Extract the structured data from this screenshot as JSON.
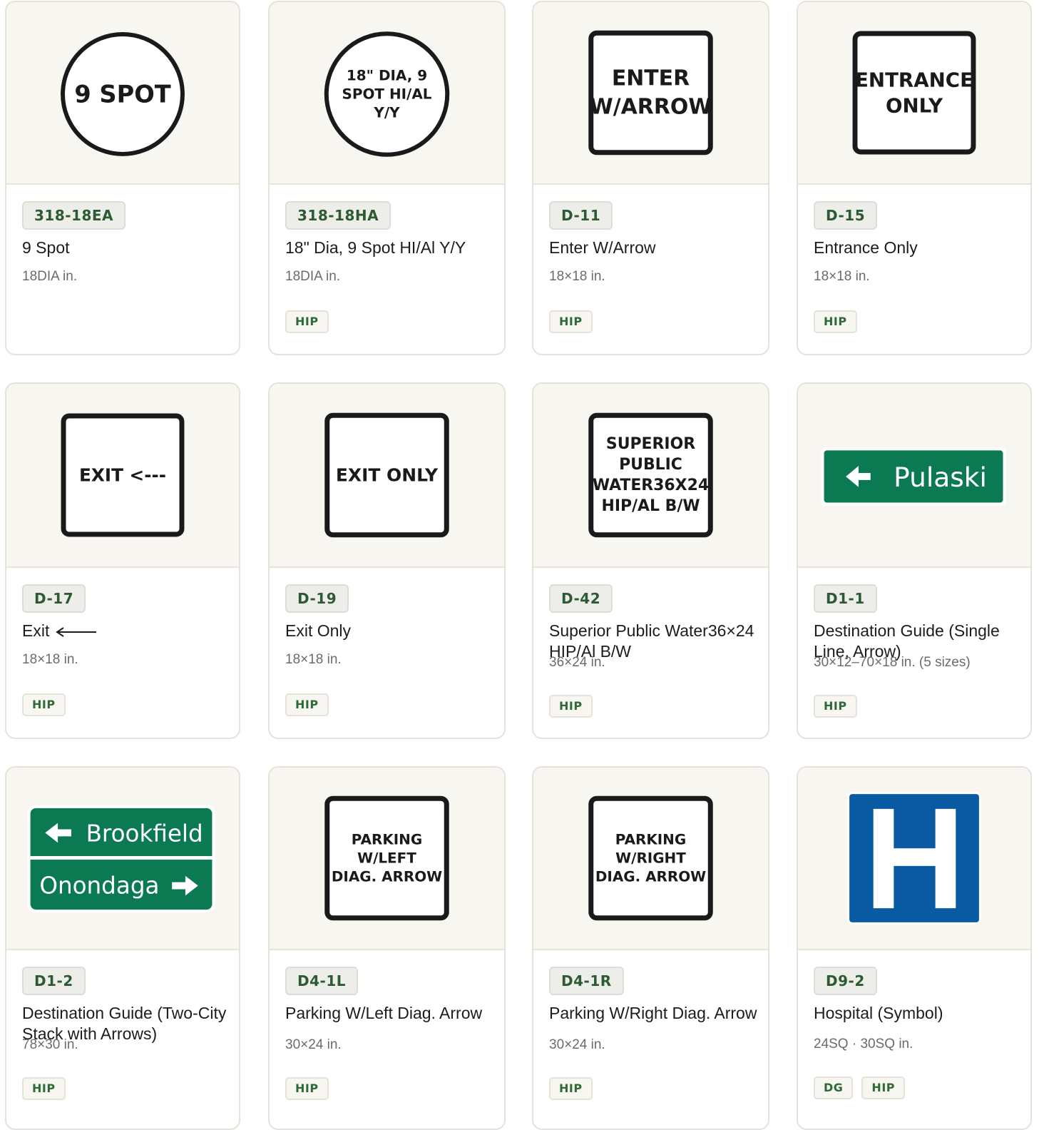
{
  "cards": [
    {
      "code": "318-18EA",
      "name": "9 Spot",
      "size": "18DIA in.",
      "tags": [],
      "sign": {
        "shape": "circle",
        "lines": [
          "9 SPOT"
        ]
      }
    },
    {
      "code": "318-18HA",
      "name": "18\" Dia, 9 Spot HI/Al Y/Y",
      "size": "18DIA in.",
      "tags": [
        "HIP"
      ],
      "sign": {
        "shape": "circle",
        "lines": [
          "18\" DIA, 9",
          "SPOT HI/AL",
          "Y/Y"
        ]
      }
    },
    {
      "code": "D-11",
      "name": "Enter W/Arrow",
      "size": "18×18 in.",
      "tags": [
        "HIP"
      ],
      "sign": {
        "shape": "square",
        "lines": [
          "ENTER",
          "W/ARROW"
        ]
      }
    },
    {
      "code": "D-15",
      "name": "Entrance Only",
      "size": "18×18 in.",
      "tags": [
        "HIP"
      ],
      "sign": {
        "shape": "square",
        "lines": [
          "ENTRANCE",
          "ONLY"
        ]
      }
    },
    {
      "code": "D-17",
      "name": "Exit",
      "size": "18×18 in.",
      "tags": [
        "HIP"
      ],
      "sign": {
        "shape": "square",
        "lines": [
          "EXIT <---"
        ]
      }
    },
    {
      "code": "D-19",
      "name": "Exit Only",
      "size": "18×18 in.",
      "tags": [
        "HIP"
      ],
      "sign": {
        "shape": "square",
        "lines": [
          "EXIT ONLY"
        ]
      }
    },
    {
      "code": "D-42",
      "name": "Superior Public Water36×24 HIP/Al B/W",
      "size": "36×24 in.",
      "tags": [
        "HIP"
      ],
      "sign": {
        "shape": "square",
        "lines": [
          "SUPERIOR",
          "PUBLIC",
          "WATER36X24",
          "HIP/AL B/W"
        ]
      }
    },
    {
      "code": "D1-1",
      "name": "Destination Guide (Single Line, Arrow)",
      "size": "30×12–70×18 in. (5 sizes)",
      "tags": [
        "HIP"
      ],
      "sign": {
        "shape": "guide-single",
        "lines": [
          "Pulaski"
        ]
      }
    },
    {
      "code": "D1-2",
      "name": "Destination Guide (Two-City Stack with Arrows)",
      "size": "78×30 in.",
      "tags": [
        "HIP"
      ],
      "sign": {
        "shape": "guide-double",
        "lines": [
          "Brookfield",
          "Onondaga"
        ]
      }
    },
    {
      "code": "D4-1L",
      "name": "Parking W/Left Diag. Arrow",
      "size": "30×24 in.",
      "tags": [
        "HIP"
      ],
      "sign": {
        "shape": "square",
        "lines": [
          "PARKING",
          "W/LEFT",
          "DIAG. ARROW"
        ]
      }
    },
    {
      "code": "D4-1R",
      "name": "Parking W/Right Diag. Arrow",
      "size": "30×24 in.",
      "tags": [
        "HIP"
      ],
      "sign": {
        "shape": "square",
        "lines": [
          "PARKING",
          "W/RIGHT",
          "DIAG. ARROW"
        ]
      }
    },
    {
      "code": "D9-2",
      "name": "Hospital (Symbol)",
      "size": "24SQ · 30SQ in.",
      "tags": [
        "DG",
        "HIP"
      ],
      "sign": {
        "shape": "hospital",
        "lines": []
      }
    }
  ],
  "colors": {
    "guide_green": "#0b7a52",
    "hospital_blue": "#0a5aa3",
    "code_text": "#2d5a32",
    "thumb_bg": "#f8f6f1"
  }
}
